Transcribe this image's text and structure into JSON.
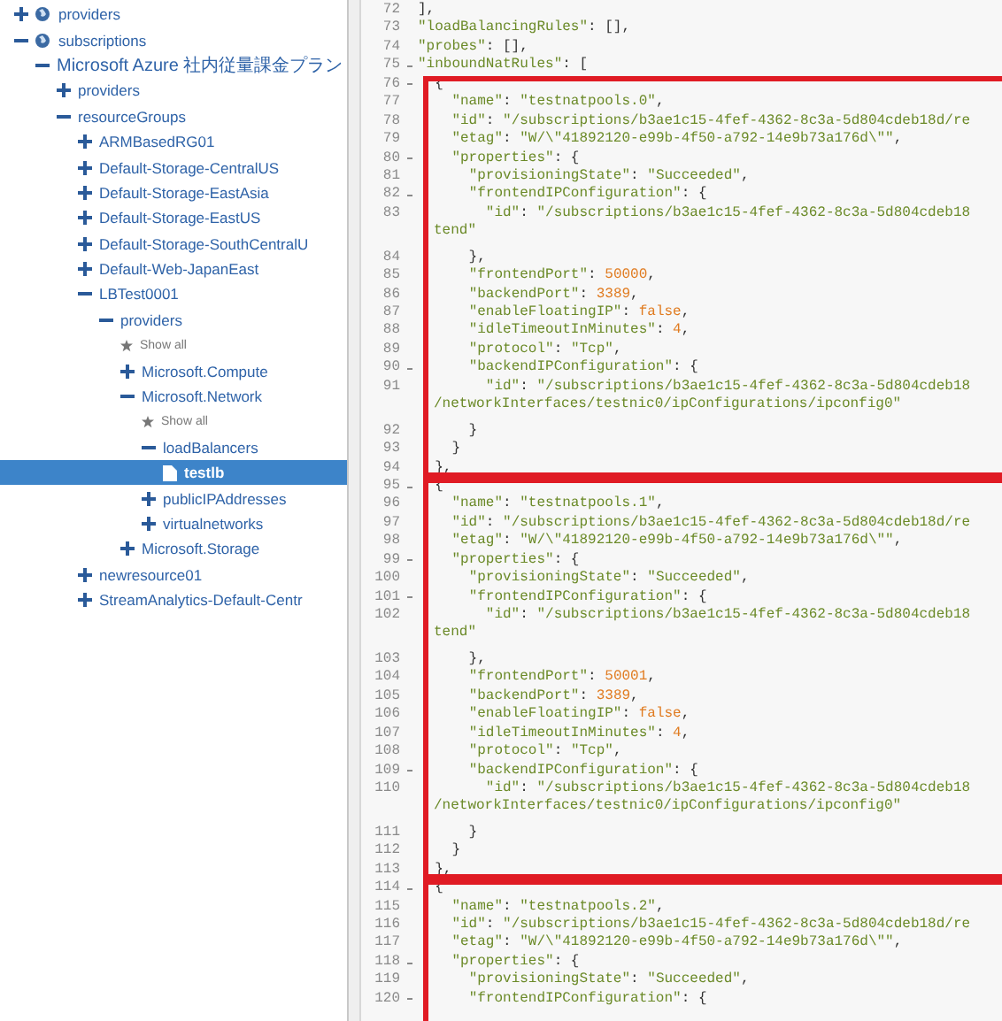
{
  "tree": [
    {
      "label": "providers",
      "kind": "root",
      "expanded": false,
      "selected": false
    },
    {
      "label": "subscriptions",
      "kind": "root",
      "expanded": true,
      "selected": false,
      "children": [
        {
          "label": "Microsoft Azure 社内従量課金プラン",
          "kind": "node",
          "expanded": true,
          "selected": false,
          "children": [
            {
              "label": "providers",
              "kind": "node",
              "expanded": false,
              "selected": false
            },
            {
              "label": "resourceGroups",
              "kind": "node",
              "expanded": true,
              "selected": false,
              "children": [
                {
                  "label": "ARMBasedRG01",
                  "kind": "node",
                  "expanded": false,
                  "selected": false
                },
                {
                  "label": "Default-Storage-CentralUS",
                  "kind": "node",
                  "expanded": false,
                  "selected": false
                },
                {
                  "label": "Default-Storage-EastAsia",
                  "kind": "node",
                  "expanded": false,
                  "selected": false
                },
                {
                  "label": "Default-Storage-EastUS",
                  "kind": "node",
                  "expanded": false,
                  "selected": false
                },
                {
                  "label": "Default-Storage-SouthCentralU",
                  "kind": "node",
                  "expanded": false,
                  "selected": false
                },
                {
                  "label": "Default-Web-JapanEast",
                  "kind": "node",
                  "expanded": false,
                  "selected": false
                },
                {
                  "label": "LBTest0001",
                  "kind": "node",
                  "expanded": true,
                  "selected": false,
                  "children": [
                    {
                      "label": "providers",
                      "kind": "node",
                      "expanded": true,
                      "selected": false,
                      "children": [
                        {
                          "label": "Show all",
                          "kind": "action",
                          "selected": false
                        },
                        {
                          "label": "Microsoft.Compute",
                          "kind": "node",
                          "expanded": false,
                          "selected": false
                        },
                        {
                          "label": "Microsoft.Network",
                          "kind": "node",
                          "expanded": true,
                          "selected": false,
                          "children": [
                            {
                              "label": "Show all",
                              "kind": "action",
                              "selected": false
                            },
                            {
                              "label": "loadBalancers",
                              "kind": "node",
                              "expanded": true,
                              "selected": false,
                              "children": [
                                {
                                  "label": "testlb",
                                  "kind": "file",
                                  "selected": true
                                }
                              ]
                            },
                            {
                              "label": "publicIPAddresses",
                              "kind": "node",
                              "expanded": false,
                              "selected": false
                            },
                            {
                              "label": "virtualnetworks",
                              "kind": "node",
                              "expanded": false,
                              "selected": false
                            }
                          ]
                        },
                        {
                          "label": "Microsoft.Storage",
                          "kind": "node",
                          "expanded": false,
                          "selected": false
                        }
                      ]
                    }
                  ]
                },
                {
                  "label": "newresource01",
                  "kind": "node",
                  "expanded": false,
                  "selected": false
                },
                {
                  "label": "StreamAnalytics-Default-Centr",
                  "kind": "node",
                  "expanded": false,
                  "selected": false
                }
              ]
            }
          ]
        }
      ]
    }
  ],
  "editor": {
    "lines": [
      {
        "number": "72",
        "fold": false,
        "text": "],"
      },
      {
        "number": "73",
        "fold": false,
        "text": "\"loadBalancingRules\": [],"
      },
      {
        "number": "74",
        "fold": false,
        "text": "\"probes\": [],"
      },
      {
        "number": "75",
        "fold": true,
        "text": "\"inboundNatRules\": ["
      }
    ],
    "frames": [
      {
        "lines": [
          {
            "number": "76",
            "fold": true,
            "text": "  {"
          },
          {
            "number": "77",
            "fold": false,
            "text": "    \"name\": \"testnatpools.0\","
          },
          {
            "number": "78",
            "fold": false,
            "text": "    \"id\": \"/subscriptions/b3ae1c15-4fef-4362-8c3a-5d804cdeb18d/re"
          },
          {
            "number": "79",
            "fold": false,
            "text": "    \"etag\": \"W/\\\"41892120-e99b-4f50-a792-14e9b73a176d\\\"\","
          },
          {
            "number": "80",
            "fold": true,
            "text": "    \"properties\": {"
          },
          {
            "number": "81",
            "fold": false,
            "text": "      \"provisioningState\": \"Succeeded\","
          },
          {
            "number": "82",
            "fold": true,
            "text": "      \"frontendIPConfiguration\": {"
          },
          {
            "number": "83",
            "fold": false,
            "text": "        \"id\": \"/subscriptions/b3ae1c15-4fef-4362-8c3a-5d804cdeb18",
            "wrap": "tend\""
          },
          {
            "number": "84",
            "fold": false,
            "text": "      },"
          },
          {
            "number": "85",
            "fold": false,
            "text": "      \"frontendPort\": 50000,"
          },
          {
            "number": "86",
            "fold": false,
            "text": "      \"backendPort\": 3389,"
          },
          {
            "number": "87",
            "fold": false,
            "text": "      \"enableFloatingIP\": false,"
          },
          {
            "number": "88",
            "fold": false,
            "text": "      \"idleTimeoutInMinutes\": 4,"
          },
          {
            "number": "89",
            "fold": false,
            "text": "      \"protocol\": \"Tcp\","
          },
          {
            "number": "90",
            "fold": true,
            "text": "      \"backendIPConfiguration\": {"
          },
          {
            "number": "91",
            "fold": false,
            "text": "        \"id\": \"/subscriptions/b3ae1c15-4fef-4362-8c3a-5d804cdeb18",
            "wrap": "/networkInterfaces/testnic0/ipConfigurations/ipconfig0\""
          },
          {
            "number": "92",
            "fold": false,
            "text": "      }"
          },
          {
            "number": "93",
            "fold": false,
            "text": "    }"
          },
          {
            "number": "94",
            "fold": false,
            "text": "  },"
          }
        ]
      },
      {
        "lines": [
          {
            "number": "95",
            "fold": true,
            "text": "  {"
          },
          {
            "number": "96",
            "fold": false,
            "text": "    \"name\": \"testnatpools.1\","
          },
          {
            "number": "97",
            "fold": false,
            "text": "    \"id\": \"/subscriptions/b3ae1c15-4fef-4362-8c3a-5d804cdeb18d/re"
          },
          {
            "number": "98",
            "fold": false,
            "text": "    \"etag\": \"W/\\\"41892120-e99b-4f50-a792-14e9b73a176d\\\"\","
          },
          {
            "number": "99",
            "fold": true,
            "text": "    \"properties\": {"
          },
          {
            "number": "100",
            "fold": false,
            "text": "      \"provisioningState\": \"Succeeded\","
          },
          {
            "number": "101",
            "fold": true,
            "text": "      \"frontendIPConfiguration\": {"
          },
          {
            "number": "102",
            "fold": false,
            "text": "        \"id\": \"/subscriptions/b3ae1c15-4fef-4362-8c3a-5d804cdeb18",
            "wrap": "tend\""
          },
          {
            "number": "103",
            "fold": false,
            "text": "      },"
          },
          {
            "number": "104",
            "fold": false,
            "text": "      \"frontendPort\": 50001,"
          },
          {
            "number": "105",
            "fold": false,
            "text": "      \"backendPort\": 3389,"
          },
          {
            "number": "106",
            "fold": false,
            "text": "      \"enableFloatingIP\": false,"
          },
          {
            "number": "107",
            "fold": false,
            "text": "      \"idleTimeoutInMinutes\": 4,"
          },
          {
            "number": "108",
            "fold": false,
            "text": "      \"protocol\": \"Tcp\","
          },
          {
            "number": "109",
            "fold": true,
            "text": "      \"backendIPConfiguration\": {"
          },
          {
            "number": "110",
            "fold": false,
            "text": "        \"id\": \"/subscriptions/b3ae1c15-4fef-4362-8c3a-5d804cdeb18",
            "wrap": "/networkInterfaces/testnic0/ipConfigurations/ipconfig0\""
          },
          {
            "number": "111",
            "fold": false,
            "text": "      }"
          },
          {
            "number": "112",
            "fold": false,
            "text": "    }"
          },
          {
            "number": "113",
            "fold": false,
            "text": "  },"
          }
        ]
      },
      {
        "lines": [
          {
            "number": "114",
            "fold": true,
            "text": "  {"
          },
          {
            "number": "115",
            "fold": false,
            "text": "    \"name\": \"testnatpools.2\","
          },
          {
            "number": "116",
            "fold": false,
            "text": "    \"id\": \"/subscriptions/b3ae1c15-4fef-4362-8c3a-5d804cdeb18d/re"
          },
          {
            "number": "117",
            "fold": false,
            "text": "    \"etag\": \"W/\\\"41892120-e99b-4f50-a792-14e9b73a176d\\\"\","
          },
          {
            "number": "118",
            "fold": true,
            "text": "    \"properties\": {"
          },
          {
            "number": "119",
            "fold": false,
            "text": "      \"provisioningState\": \"Succeeded\","
          },
          {
            "number": "120",
            "fold": true,
            "text": "      \"frontendIPConfiguration\": {"
          }
        ]
      }
    ]
  }
}
